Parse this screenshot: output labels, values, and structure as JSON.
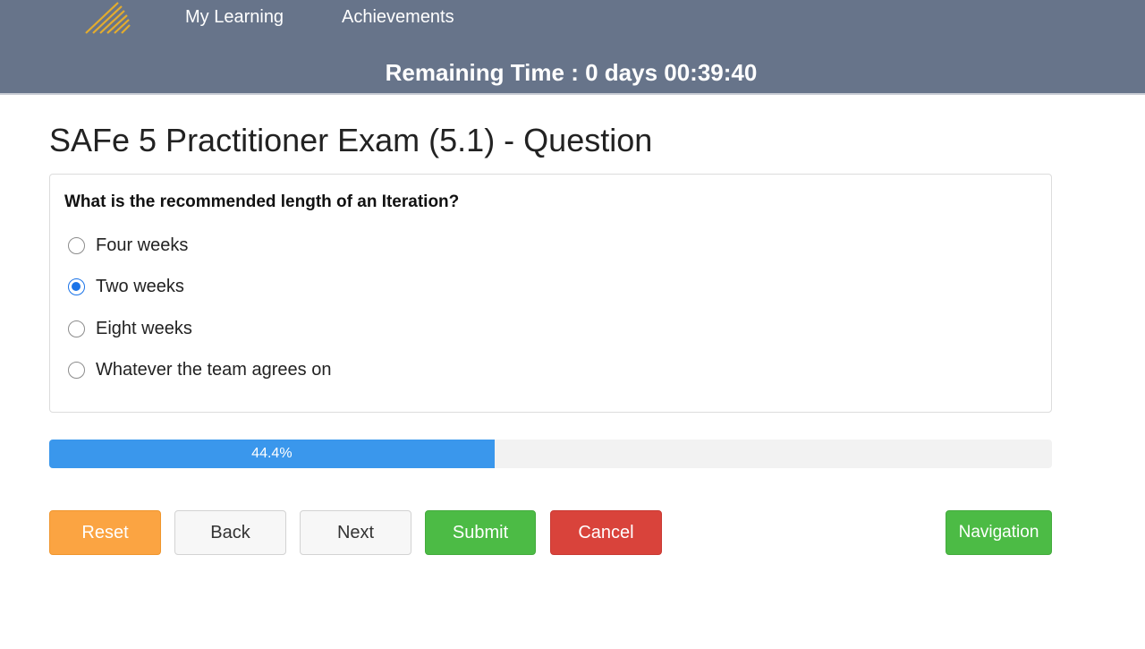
{
  "header": {
    "nav": [
      {
        "label": "My Learning"
      },
      {
        "label": "Achievements"
      }
    ],
    "timer_label": "Remaining Time : 0 days 00:39:40",
    "logo_icon": "striped-logo-icon",
    "background_color": "#67748a",
    "logo_color": "#e3ac2e"
  },
  "page": {
    "title": "SAFe 5 Practitioner Exam (5.1) - Question"
  },
  "question": {
    "text": "What is the recommended length of an Iteration?",
    "options": [
      {
        "label": "Four weeks",
        "selected": false
      },
      {
        "label": "Two weeks",
        "selected": true
      },
      {
        "label": "Eight weeks",
        "selected": false
      },
      {
        "label": "Whatever the team agrees on",
        "selected": false
      }
    ]
  },
  "progress": {
    "percent": 44.4,
    "label": "44.4%",
    "fill_color": "#3a97ec"
  },
  "buttons": {
    "reset": "Reset",
    "back": "Back",
    "next": "Next",
    "submit": "Submit",
    "cancel": "Cancel",
    "navigation": "Navigation"
  }
}
